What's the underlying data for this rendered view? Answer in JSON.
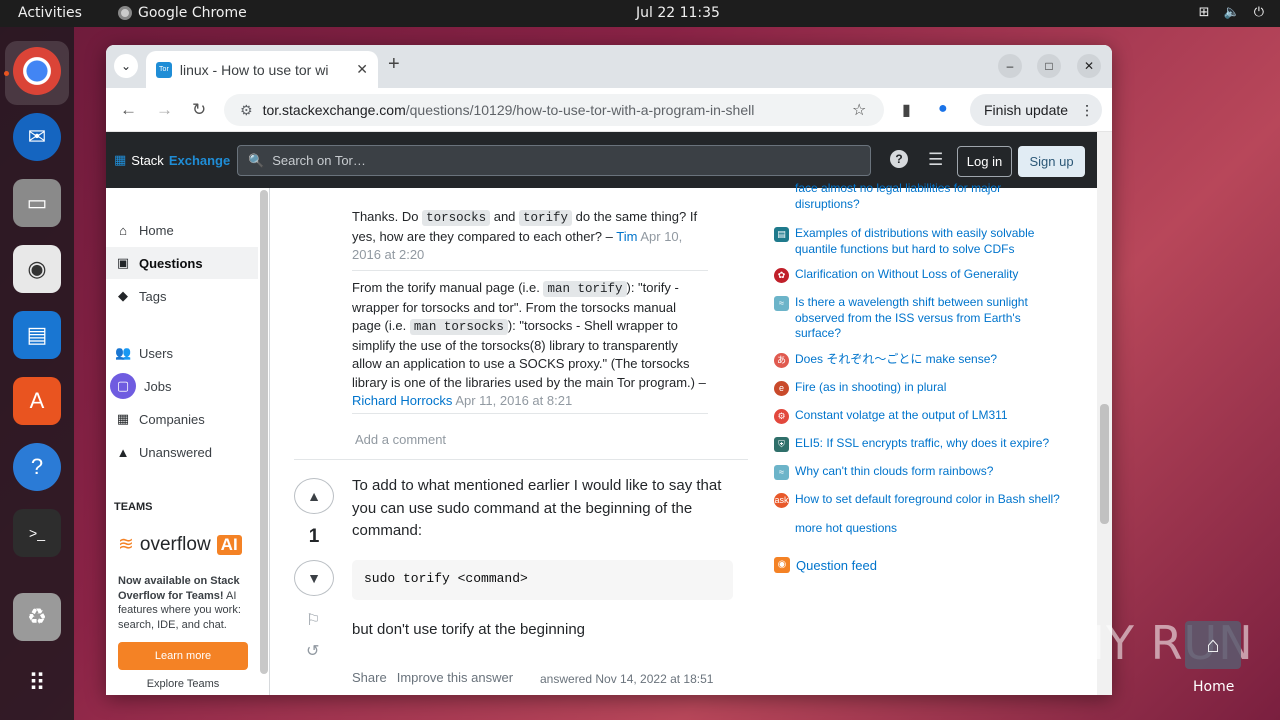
{
  "topbar": {
    "activities": "Activities",
    "app_name": "Google Chrome",
    "clock": "Jul 22  11:35"
  },
  "browser": {
    "tab_title": "linux - How to use tor wi",
    "tab_favicon": "Tor",
    "url_domain": "tor.stackexchange.com",
    "url_path": "/questions/10129/how-to-use-tor-with-a-program-in-shell",
    "finish_update": "Finish update"
  },
  "se_header": {
    "logo_a": "Stack",
    "logo_b": "Exchange",
    "search_placeholder": "Search on Tor…",
    "help": "?",
    "login": "Log in",
    "signup": "Sign up"
  },
  "left_nav": {
    "items": [
      {
        "label": "Home",
        "icon": "home-icon"
      },
      {
        "label": "Questions",
        "icon": "questions-icon"
      },
      {
        "label": "Tags",
        "icon": "tag-icon"
      },
      {
        "label": "Users",
        "icon": "users-icon"
      },
      {
        "label": "Jobs",
        "icon": "briefcase-icon"
      },
      {
        "label": "Companies",
        "icon": "companies-icon"
      },
      {
        "label": "Unanswered",
        "icon": "unanswered-icon"
      }
    ],
    "teams_heading": "TEAMS",
    "overflow_ai_word": "overflow",
    "overflow_ai_badge": "AI",
    "teams_bold": "Now available on Stack Overflow for Teams!",
    "teams_text": " AI features where you work: search, IDE, and chat.",
    "learn_more": "Learn more",
    "explore_teams": "Explore Teams"
  },
  "comments": [
    {
      "pre": "Thanks. Do ",
      "code1": "torsocks",
      "mid": " and ",
      "code2": "torify",
      "post": " do the same thing? If yes, how are they compared to each other? – ",
      "user": "Tim",
      "date": "Apr 10, 2016 at 2:20"
    },
    {
      "t1": "From the torify manual page (i.e. ",
      "code1": "man torify",
      "t2": "): \"torify - wrapper for torsocks and tor\". From the torsocks manual page (i.e. ",
      "code2": "man torsocks",
      "t3": "): \"torsocks - Shell wrapper to simplify the use of the torsocks(8) library to transparently allow an application to use a SOCKS proxy.\" (The torsocks library is one of the libraries used by the main Tor program.) – ",
      "user": "Richard Horrocks",
      "date": "Apr 11, 2016 at 8:21"
    }
  ],
  "add_comment": "Add a comment",
  "answer": {
    "score": "1",
    "p1": "To add to what mentioned earlier I would like to say that you can use sudo command at the beginning of the command:",
    "code": "sudo torify <command>",
    "p2": "but don't use torify at the beginning",
    "share": "Share",
    "improve": "Improve this answer",
    "answered": "answered Nov 14, 2022 at 18:51"
  },
  "hot_questions": [
    {
      "text": "face almost no legal liabilities for major disruptions?",
      "color": "#d0393e"
    },
    {
      "text": "Examples of distributions with easily solvable quantile functions but hard to solve CDFs",
      "color": "#1f7a8c"
    },
    {
      "text": "Clarification on Without Loss of Generality",
      "color": "#c0202a"
    },
    {
      "text": "Is there a wavelength shift between sunlight observed from the ISS versus from Earth's surface?",
      "color": "#6cb4c9"
    },
    {
      "text": "Does それぞれ〜ごとに make sense?",
      "color": "#e05a4f"
    },
    {
      "text": "Fire (as in shooting) in plural",
      "color": "#c94a2b"
    },
    {
      "text": "Constant volatge at the output of LM311",
      "color": "#e2483d"
    },
    {
      "text": "ELI5: If SSL encrypts traffic, why does it expire?",
      "color": "#2f6f6a"
    },
    {
      "text": "Why can't thin clouds form rainbows?",
      "color": "#6cb4c9"
    },
    {
      "text": "How to set default foreground color in Bash shell?",
      "color": "#e8592a"
    }
  ],
  "more_hot": "more hot questions",
  "question_feed": "Question feed",
  "watermark": "ANY RUN",
  "desktop_home": "Home"
}
